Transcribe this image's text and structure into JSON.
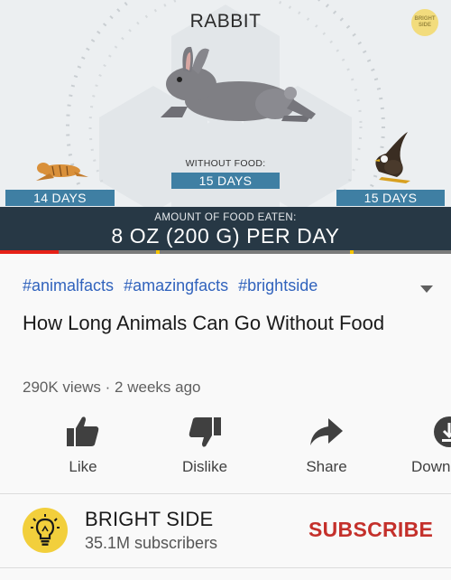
{
  "video": {
    "animal_title": "RABBIT",
    "brand_badge": "BRIGHT SIDE",
    "without_food_label": "WITHOUT FOOD:",
    "days_left": "14 DAYS",
    "days_center": "15 DAYS",
    "days_right": "15 DAYS",
    "food_label": "AMOUNT OF FOOD EATEN:",
    "food_amount": "8 OZ (200 G) PER DAY",
    "progress_fraction": 0.13,
    "accent_red": "#e62117",
    "pill_blue": "#3f7fa3",
    "banner_color": "#273845"
  },
  "info": {
    "hashtags": [
      "#animalfacts",
      "#amazingfacts",
      "#brightside"
    ],
    "title": "How Long Animals Can Go Without Food",
    "meta": "290K views · 2 weeks ago",
    "expand_icon": "chevron-down-icon"
  },
  "actions": {
    "like": "Like",
    "dislike": "Dislike",
    "share": "Share",
    "download": "Down"
  },
  "channel": {
    "name": "BRIGHT SIDE",
    "subscribers": "35.1M subscribers",
    "subscribe_label": "SUBSCRIBE",
    "avatar_icon": "lightbulb-icon",
    "subscribe_color": "#c4302b"
  }
}
